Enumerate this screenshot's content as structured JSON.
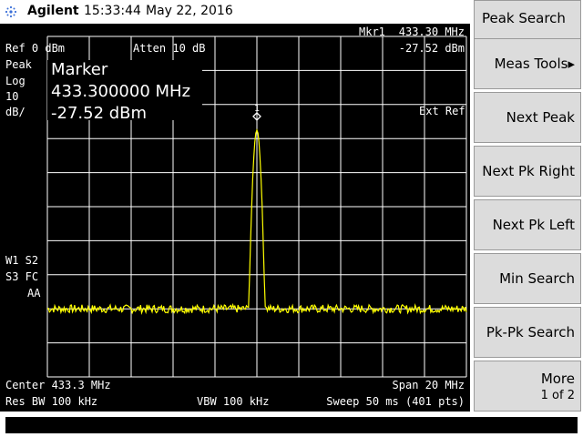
{
  "title_bar": {
    "brand": "Agilent",
    "time": "15:33:44",
    "date": "May 22, 2016"
  },
  "display": {
    "ref_level": "Ref 0 dBm",
    "attenuation": "Atten 10 dB",
    "marker_readout_label": "Mkr1",
    "marker_readout_freq": "433.30 MHz",
    "marker_readout_amp": "-27.52 dBm",
    "scale_lines": [
      "Peak",
      "Log",
      "10",
      "dB/"
    ],
    "marker_box": {
      "title": "Marker",
      "freq": "433.300000 MHz",
      "amp": "-27.52 dBm"
    },
    "ext_ref": "Ext Ref",
    "left_annotations": [
      "W1 S2",
      "S3 FC",
      "AA"
    ],
    "marker_number": "1",
    "center": "Center 433.3 MHz",
    "span": "Span 20 MHz",
    "res_bw": "Res BW 100 kHz",
    "vbw": "VBW 100 kHz",
    "sweep": "Sweep 50 ms (401 pts)"
  },
  "trace": {
    "center_mhz": 433.3,
    "span_mhz": 20,
    "ref_dbm": 0,
    "db_per_div": 10,
    "divisions": 10,
    "peak_dbm": -27.52,
    "noise_floor_dbm": -80,
    "points": 401,
    "color": "#ffff00"
  },
  "softkeys": [
    {
      "label": "Peak Search"
    },
    {
      "label": "Meas Tools▸"
    },
    {
      "label": "Next Peak"
    },
    {
      "label": "Next Pk Right"
    },
    {
      "label": "Next Pk Left"
    },
    {
      "label": "Min Search"
    },
    {
      "label": "Pk-Pk Search"
    },
    {
      "label": "More",
      "sub": "1 of 2"
    }
  ]
}
